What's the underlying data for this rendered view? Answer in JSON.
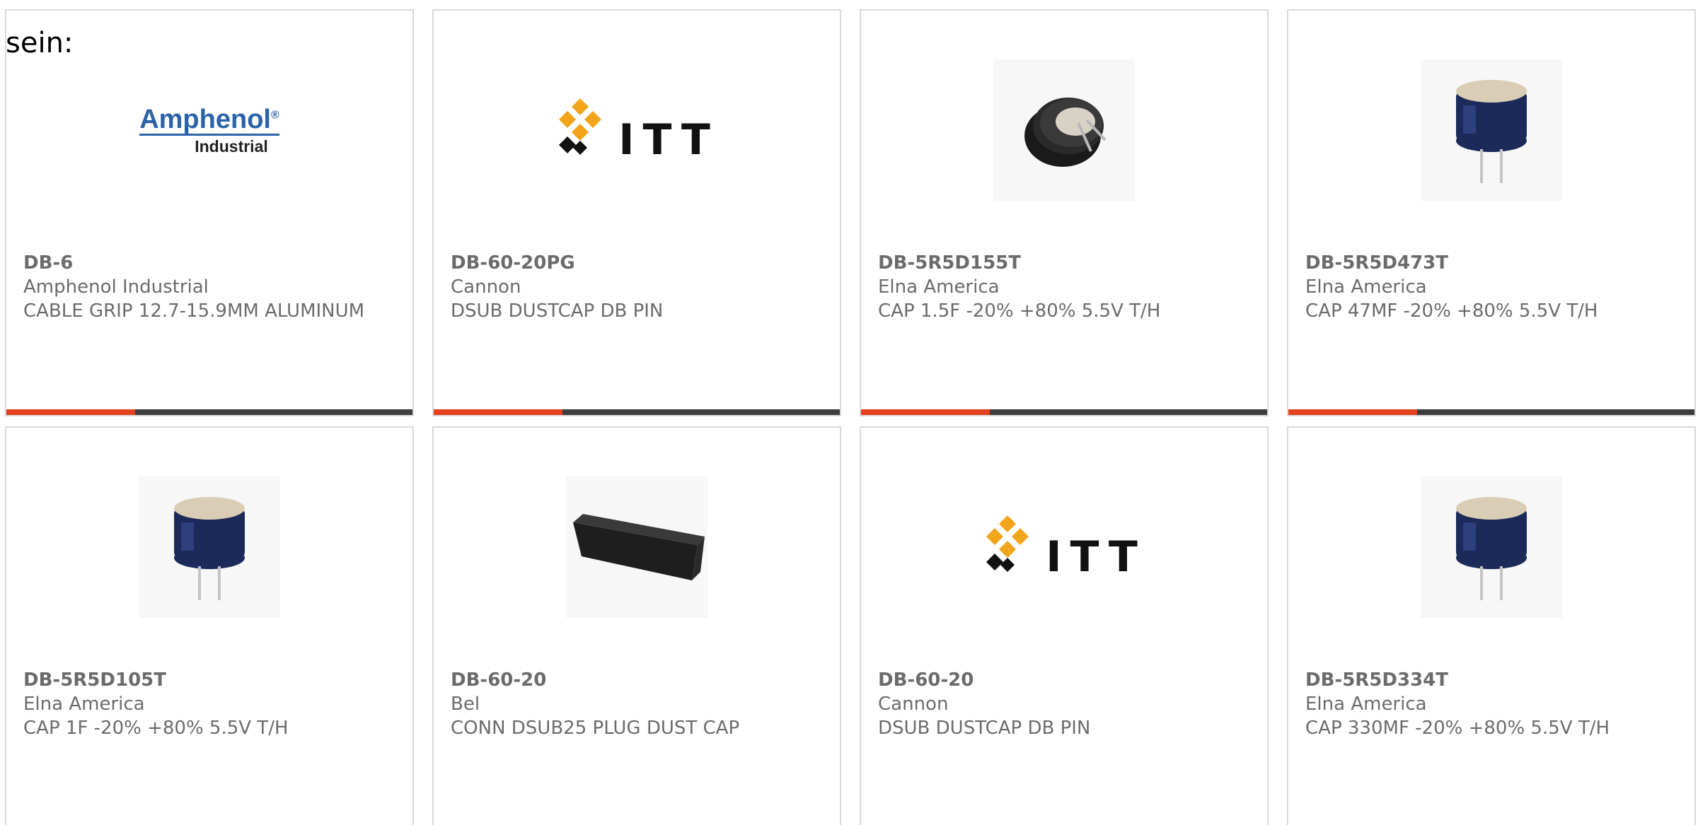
{
  "intro_text": "sein:",
  "products": [
    {
      "part_number": "DB-6",
      "manufacturer": "Amphenol Industrial",
      "description": "CABLE GRIP 12.7-15.9MM ALUMINUM",
      "image": "amphenol-industrial-logo",
      "logo_text_1": "Amphenol",
      "logo_mark": "®",
      "logo_text_2": "Industrial"
    },
    {
      "part_number": "DB-60-20PG",
      "manufacturer": "Cannon",
      "description": "DSUB DUSTCAP DB PIN",
      "image": "itt-logo",
      "logo_text": "ITT"
    },
    {
      "part_number": "DB-5R5D155T",
      "manufacturer": "Elna America",
      "description": "CAP 1.5F -20% +80% 5.5V T/H",
      "image": "coin-supercapacitor-photo"
    },
    {
      "part_number": "DB-5R5D473T",
      "manufacturer": "Elna America",
      "description": "CAP 47MF -20% +80% 5.5V T/H",
      "image": "radial-capacitor-photo"
    },
    {
      "part_number": "DB-5R5D105T",
      "manufacturer": "Elna America",
      "description": "CAP 1F -20% +80% 5.5V T/H",
      "image": "radial-capacitor-photo"
    },
    {
      "part_number": "DB-60-20",
      "manufacturer": "Bel",
      "description": "CONN DSUB25 PLUG DUST CAP",
      "image": "dust-cap-photo"
    },
    {
      "part_number": "DB-60-20",
      "manufacturer": "Cannon",
      "description": "DSUB DUSTCAP DB PIN",
      "image": "itt-logo",
      "logo_text": "ITT"
    },
    {
      "part_number": "DB-5R5D334T",
      "manufacturer": "Elna America",
      "description": "CAP 330MF -20% +80% 5.5V T/H",
      "image": "radial-capacitor-photo"
    }
  ],
  "colors": {
    "accent": "#e2401c",
    "bar": "#3d3d3d",
    "text": "#6b6b6b",
    "border": "#d9d9d9",
    "amphenol_blue": "#2b63a8",
    "itt_orange": "#f2a41a"
  }
}
